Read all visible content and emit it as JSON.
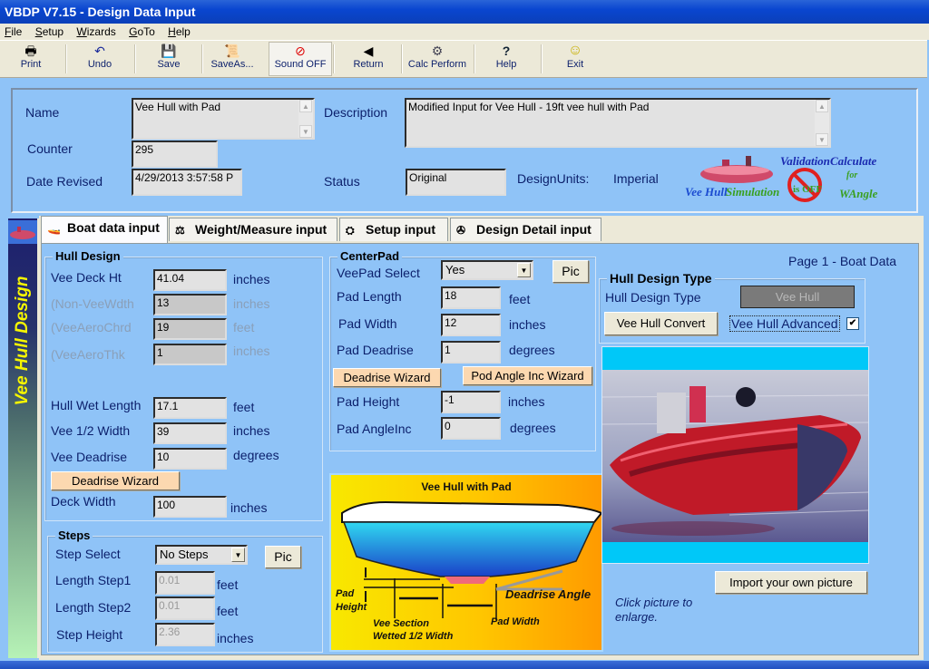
{
  "window": {
    "title": "VBDP V7.15 - Design Data Input"
  },
  "menu": [
    {
      "label": "File",
      "accel": "F"
    },
    {
      "label": "Setup",
      "accel": "S"
    },
    {
      "label": "Wizards",
      "accel": "W"
    },
    {
      "label": "GoTo",
      "accel": "G"
    },
    {
      "label": "Help",
      "accel": "H"
    }
  ],
  "toolbar": [
    {
      "label": "Print",
      "icon": "printer-icon",
      "glyph": "🖶"
    },
    {
      "label": "Undo",
      "icon": "undo-icon",
      "glyph": "↶"
    },
    {
      "label": "Save",
      "icon": "floppy-disk-icon",
      "glyph": "💾"
    },
    {
      "label": "SaveAs...",
      "icon": "save-as-icon",
      "glyph": "📜"
    },
    {
      "label": "Sound OFF",
      "icon": "sound-off-icon",
      "glyph": "⊘"
    },
    {
      "label": "Return",
      "icon": "return-arrow-icon",
      "glyph": "◀"
    },
    {
      "label": "Calc Perform",
      "icon": "calc-perform-icon",
      "glyph": "⚙"
    },
    {
      "label": "Help",
      "icon": "help-icon",
      "glyph": "?"
    },
    {
      "label": "Exit",
      "icon": "smiley-exit-icon",
      "glyph": "☺"
    }
  ],
  "header": {
    "name_label": "Name",
    "name_value": "Vee Hull with Pad",
    "description_label": "Description",
    "description_value": "Modified Input for Vee Hull  - 19ft vee hull with Pad",
    "counter_label": "Counter",
    "counter_value": "295",
    "date_label": "Date Revised",
    "date_value": "4/29/2013 3:57:58 P",
    "status_label": "Status",
    "status_value": "Original",
    "units_label": "DesignUnits:",
    "units_value": "Imperial",
    "logos": {
      "vee_hull": "Vee Hull",
      "simulation": "Simulation",
      "validation": "Validation",
      "validation_off": "is OFF",
      "calculate": "Calculate",
      "wangle": "WAngle",
      "for": "for"
    }
  },
  "sidebar": {
    "title": "Vee Hull Design"
  },
  "tabs": [
    {
      "label": "Boat data input",
      "active": true
    },
    {
      "label": "Weight/Measure input",
      "active": false
    },
    {
      "label": "Setup input",
      "active": false
    },
    {
      "label": "Design Detail input",
      "active": false
    }
  ],
  "page_label": "Page 1 - Boat Data",
  "hull_design": {
    "title": "Hull Design",
    "fields": [
      {
        "label": "Vee Deck Ht",
        "value": "41.04",
        "unit": "inches",
        "enabled": true
      },
      {
        "label": "(Non-VeeWdth",
        "value": "13",
        "unit": "inches",
        "enabled": false
      },
      {
        "label": "(VeeAeroChrd",
        "value": "19",
        "unit": "feet",
        "enabled": false
      },
      {
        "label": "(VeeAeroThk",
        "value": "1",
        "unit": "inches",
        "enabled": false
      },
      {
        "label": "Hull Wet Length",
        "value": "17.1",
        "unit": "feet",
        "enabled": true
      },
      {
        "label": "Vee 1/2 Width",
        "value": "39",
        "unit": "inches",
        "enabled": true
      },
      {
        "label": "Vee Deadrise",
        "value": "10",
        "unit": "degrees",
        "enabled": true
      },
      {
        "label": "Deck Width",
        "value": "100",
        "unit": "inches",
        "enabled": true
      }
    ],
    "deadrise_wizard": "Deadrise Wizard"
  },
  "steps": {
    "title": "Steps",
    "step_select_label": "Step Select",
    "step_select_value": "No Steps",
    "pic_button": "Pic",
    "fields": [
      {
        "label": "Length Step1",
        "value": "0.01",
        "unit": "feet"
      },
      {
        "label": "Length Step2",
        "value": "0.01",
        "unit": "feet"
      },
      {
        "label": "Step Height",
        "value": "2.36",
        "unit": "inches"
      }
    ]
  },
  "center_pad": {
    "title": "CenterPad",
    "veepad_select_label": "VeePad Select",
    "veepad_select_value": "Yes",
    "pic_button": "Pic",
    "fields": [
      {
        "label": "Pad Length",
        "value": "18",
        "unit": "feet"
      },
      {
        "label": "Pad Width",
        "value": "12",
        "unit": "inches"
      },
      {
        "label": "Pad Deadrise",
        "value": "1",
        "unit": "degrees"
      },
      {
        "label": "Pad Height",
        "value": "-1",
        "unit": "inches"
      },
      {
        "label": "Pad AngleInc",
        "value": "0",
        "unit": "degrees"
      }
    ],
    "deadrise_wizard": "Deadrise Wizard",
    "pod_angle_wizard": "Pod Angle Inc Wizard"
  },
  "diagram": {
    "title": "Vee Hull with Pad",
    "labels": {
      "pad_height_1": "Pad",
      "pad_height_2": "Height",
      "vee_section_1": "Vee Section",
      "vee_section_2": "Wetted 1/2 Width",
      "pad_width": "Pad Width",
      "deadrise_angle": "Deadrise Angle"
    }
  },
  "hull_design_type": {
    "title": "Hull Design Type",
    "label": "Hull Design Type",
    "value": "Vee Hull",
    "convert_button": "Vee Hull Convert",
    "advanced_label": "Vee Hull Advanced",
    "advanced_checked": true
  },
  "picture": {
    "import_button": "Import your own picture",
    "hint": "Click picture to enlarge."
  }
}
